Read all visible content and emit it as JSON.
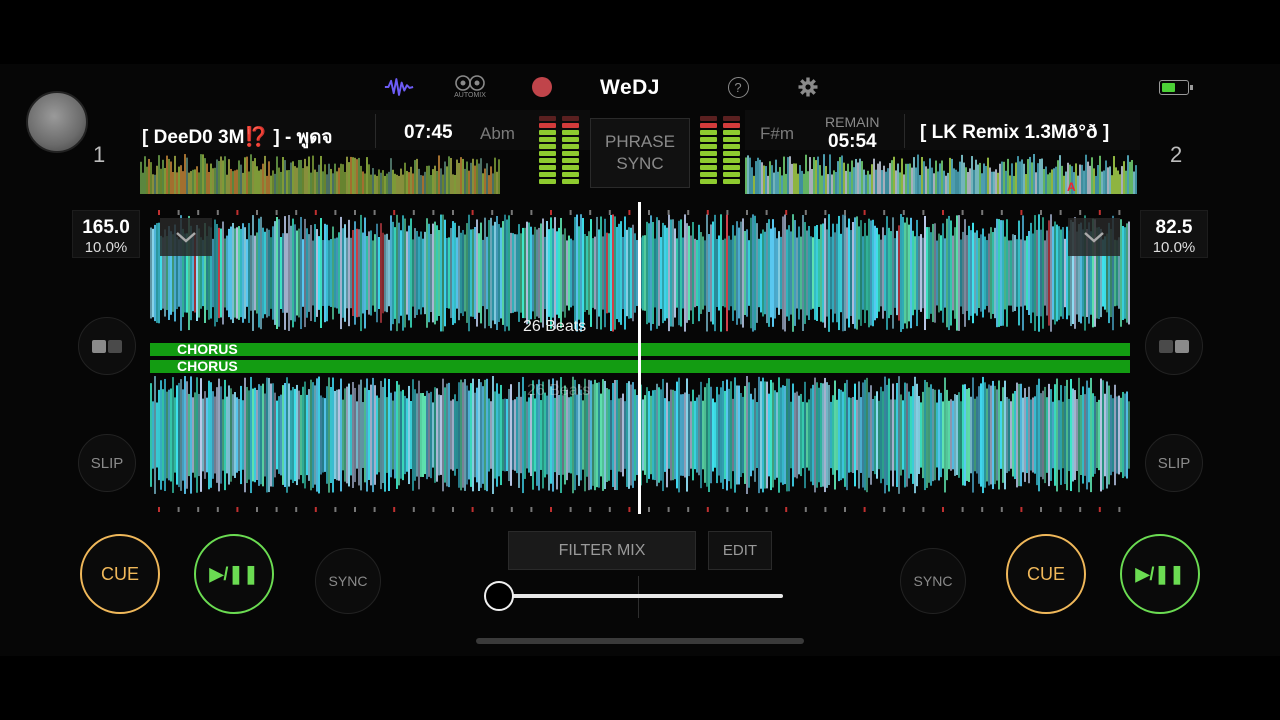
{
  "app": {
    "name": "WeDJ",
    "automix_label": "AUTOMIX"
  },
  "colors": {
    "accent_purple": "#6d5cf5",
    "record_red": "#c0444a",
    "cue_orange": "#f0b85a",
    "play_green": "#6bdc52",
    "chorus_green": "#139c12",
    "battery_green": "#4cd137",
    "waveform_cyan": "#3fe3ee"
  },
  "icons": {
    "waveform": "waveform-icon",
    "automix": "automix-icon",
    "record": "record-icon",
    "help": "help-icon",
    "settings": "gear-icon",
    "battery": "battery-icon"
  },
  "deck1": {
    "number": "1",
    "title": "[ DeeD0 3M⁉️ ] - พูดจ",
    "elapsed": "07:45",
    "key": "Abm",
    "bpm": "165.0",
    "pitch": "10.0%",
    "cue": "CUE",
    "play": "▶/❚❚",
    "sync": "SYNC",
    "slip": "SLIP",
    "beats": "26 Beats"
  },
  "deck2": {
    "number": "2",
    "title": "[ LK Remix 1.3Mð°ð ]",
    "remain_label": "REMAIN",
    "remain": "05:54",
    "key": "F#m",
    "bpm": "82.5",
    "pitch": "10.0%",
    "cue": "CUE",
    "play": "▶/❚❚",
    "sync": "SYNC",
    "slip": "SLIP",
    "beats": "26 Beats",
    "overview_marker": "A"
  },
  "center": {
    "phrase_sync": [
      "PHRASE",
      "SYNC"
    ],
    "filter_mix": "FILTER MIX",
    "edit": "EDIT",
    "crossfader": 0
  },
  "phrases": {
    "deck1": "CHORUS",
    "deck2": "CHORUS"
  }
}
